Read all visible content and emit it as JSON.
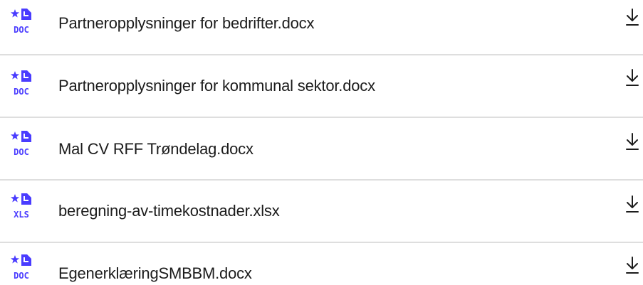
{
  "files": [
    {
      "name": "Partneropplysninger for bedrifter.docx",
      "type_badge": "DOC",
      "icon": "doc-file-icon",
      "action_icon": "download-icon"
    },
    {
      "name": "Partneropplysninger for kommunal sektor.docx",
      "type_badge": "DOC",
      "icon": "doc-file-icon",
      "action_icon": "download-icon"
    },
    {
      "name": "Mal CV RFF Trøndelag.docx",
      "type_badge": "DOC",
      "icon": "doc-file-icon",
      "action_icon": "download-icon"
    },
    {
      "name": "beregning-av-timekostnader.xlsx",
      "type_badge": "XLS",
      "icon": "xls-file-icon",
      "action_icon": "download-icon"
    },
    {
      "name": "EgenerklæringSMBBM.docx",
      "type_badge": "DOC",
      "icon": "doc-file-icon",
      "action_icon": "download-icon"
    }
  ],
  "colors": {
    "icon_accent": "#4a3cff",
    "text": "#1c1c1c",
    "divider": "#dedede",
    "background": "#ffffff"
  }
}
